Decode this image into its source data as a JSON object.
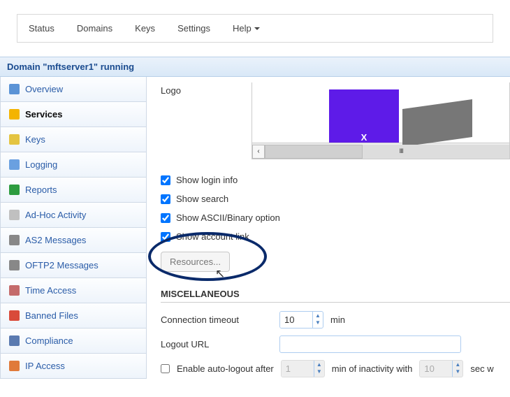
{
  "topnav": {
    "items": [
      "Status",
      "Domains",
      "Keys",
      "Settings",
      "Help"
    ],
    "help_has_caret": true
  },
  "domain_bar": "Domain \"mftserver1\" running",
  "sidebar": {
    "items": [
      {
        "label": "Overview",
        "icon": "overview-icon",
        "color": "#5a93d6"
      },
      {
        "label": "Services",
        "icon": "services-icon",
        "color": "#f4b400",
        "active": true
      },
      {
        "label": "Keys",
        "icon": "keys-icon",
        "color": "#e4c441"
      },
      {
        "label": "Logging",
        "icon": "logging-icon",
        "color": "#6aa0e0"
      },
      {
        "label": "Reports",
        "icon": "reports-icon",
        "color": "#2d9c3f"
      },
      {
        "label": "Ad-Hoc Activity",
        "icon": "adhoc-icon",
        "color": "#c0c0c0"
      },
      {
        "label": "AS2 Messages",
        "icon": "as2-icon",
        "color": "#888"
      },
      {
        "label": "OFTP2 Messages",
        "icon": "oftp2-icon",
        "color": "#888"
      },
      {
        "label": "Time Access",
        "icon": "time-icon",
        "color": "#c46b6b"
      },
      {
        "label": "Banned Files",
        "icon": "banned-icon",
        "color": "#d94a3a"
      },
      {
        "label": "Compliance",
        "icon": "compliance-icon",
        "color": "#5a7ab0"
      },
      {
        "label": "IP Access",
        "icon": "ipaccess-icon",
        "color": "#e07a3a"
      }
    ]
  },
  "main": {
    "logo_label": "Logo",
    "logo_letter": "X",
    "checkboxes": [
      {
        "label": "Show login info",
        "checked": true
      },
      {
        "label": "Show search",
        "checked": true
      },
      {
        "label": "Show ASCII/Binary option",
        "checked": true
      },
      {
        "label": "Show account link",
        "checked": true
      }
    ],
    "resources_btn": "Resources...",
    "misc_header": "MISCELLANEOUS",
    "conn_timeout": {
      "label": "Connection timeout",
      "value": "10",
      "unit": "min"
    },
    "logout_url": {
      "label": "Logout URL",
      "value": ""
    },
    "auto_logout": {
      "label": "Enable auto-logout after",
      "checked": false,
      "minutes": "1",
      "mid": "min of inactivity with",
      "seconds": "10",
      "tail": "sec w"
    }
  }
}
